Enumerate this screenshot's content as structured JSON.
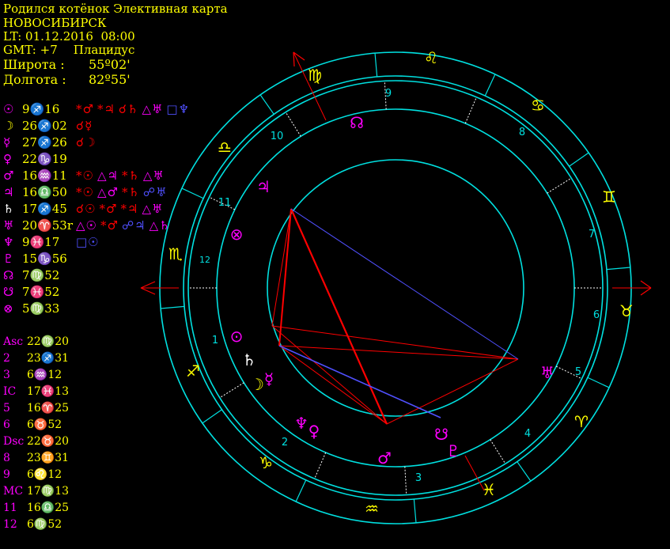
{
  "header": {
    "title": "Родился котёнок Элективная карта",
    "city": "НОВОСИБИРСК",
    "local_time": "LT: 01.12.2016  08:00",
    "gmt": "GMT: +7",
    "house_system": "Плацидус",
    "lat_label": "Широта :",
    "lat_value": "55º02'",
    "lon_label": "Долгота :",
    "lon_value": "82º55'"
  },
  "colors": {
    "ring": "#00e0e0",
    "text_yellow": "#ffff00",
    "magenta": "#ff00ff",
    "red": "#ff0000",
    "blue": "#5050ff",
    "white": "#ffffff"
  },
  "planets": [
    {
      "glyph": "☉",
      "color": "#ff00ff",
      "pos": "9♐16",
      "aspects": [
        {
          "t": "*♂",
          "c": "#ff0000"
        },
        {
          "t": "*♃",
          "c": "#ff0000"
        },
        {
          "t": "☌♄",
          "c": "#ff0000"
        },
        {
          "t": "△♅",
          "c": "#ff00ff"
        },
        {
          "t": "□♆",
          "c": "#5050ff"
        }
      ]
    },
    {
      "glyph": "☽",
      "color": "#ffff00",
      "pos": "26♐02",
      "aspects": [
        {
          "t": "☌☿",
          "c": "#ff0000"
        }
      ]
    },
    {
      "glyph": "☿",
      "color": "#ff00ff",
      "pos": "27♐26",
      "aspects": [
        {
          "t": "☌☽",
          "c": "#ff0000"
        }
      ]
    },
    {
      "glyph": "♀",
      "color": "#ff00ff",
      "pos": "22♑19",
      "aspects": []
    },
    {
      "glyph": "♂",
      "color": "#ff00ff",
      "pos": "16♒11",
      "aspects": [
        {
          "t": "*☉",
          "c": "#ff0000"
        },
        {
          "t": "△♃",
          "c": "#ff00ff"
        },
        {
          "t": "*♄",
          "c": "#ff0000"
        },
        {
          "t": "△♅",
          "c": "#ff00ff"
        }
      ]
    },
    {
      "glyph": "♃",
      "color": "#ff00ff",
      "pos": "16♎50",
      "aspects": [
        {
          "t": "*☉",
          "c": "#ff0000"
        },
        {
          "t": "△♂",
          "c": "#ff00ff"
        },
        {
          "t": "*♄",
          "c": "#ff0000"
        },
        {
          "t": "☍♅",
          "c": "#5050ff"
        }
      ]
    },
    {
      "glyph": "♄",
      "color": "#ffffff",
      "pos": "17♐45",
      "aspects": [
        {
          "t": "☌☉",
          "c": "#ff0000"
        },
        {
          "t": "*♂",
          "c": "#ff0000"
        },
        {
          "t": "*♃",
          "c": "#ff0000"
        },
        {
          "t": "△♅",
          "c": "#ff00ff"
        }
      ]
    },
    {
      "glyph": "♅",
      "color": "#ff00ff",
      "pos": "20♈53r",
      "aspects": [
        {
          "t": "△☉",
          "c": "#ff00ff"
        },
        {
          "t": "*♂",
          "c": "#ff0000"
        },
        {
          "t": "☍♃",
          "c": "#5050ff"
        },
        {
          "t": "△♄",
          "c": "#ff00ff"
        }
      ]
    },
    {
      "glyph": "♆",
      "color": "#ff00ff",
      "pos": "9♓17",
      "aspects": [
        {
          "t": "□☉",
          "c": "#5050ff"
        }
      ]
    },
    {
      "glyph": "♇",
      "color": "#ff00ff",
      "pos": "15♑56",
      "aspects": []
    },
    {
      "glyph": "☊",
      "color": "#ff00ff",
      "pos": "7♍52",
      "aspects": []
    },
    {
      "glyph": "☋",
      "color": "#ff00ff",
      "pos": "7♓52",
      "aspects": []
    },
    {
      "glyph": "⊗",
      "color": "#ff00ff",
      "pos": "5♍33",
      "aspects": []
    }
  ],
  "houses": [
    {
      "label": "Asc",
      "value": "22♍20"
    },
    {
      "label": "2",
      "value": "23♐31"
    },
    {
      "label": "3",
      "value": "6♒12"
    },
    {
      "label": "IC",
      "value": "17♓13"
    },
    {
      "label": "5",
      "value": "16♈25"
    },
    {
      "label": "6",
      "value": "6♉52"
    },
    {
      "label": "Dsc",
      "value": "22♉20"
    },
    {
      "label": "8",
      "value": "23♊31"
    },
    {
      "label": "9",
      "value": "6♌12"
    },
    {
      "label": "MC",
      "value": "17♍13"
    },
    {
      "label": "11",
      "value": "16♎25"
    },
    {
      "label": "12",
      "value": "6♍52"
    }
  ],
  "wheel": {
    "house_numbers": [
      "1",
      "2",
      "3",
      "4",
      "5",
      "6",
      "7",
      "8",
      "9",
      "10",
      "11",
      "12"
    ],
    "signs": [
      "♈",
      "♉",
      "♊",
      "♋",
      "♌",
      "♍",
      "♎",
      "♏",
      "♐",
      "♑",
      "♒",
      "♓"
    ]
  },
  "chart_planets": [
    {
      "glyph": "⊙",
      "color": "#ff00ff",
      "name": "sun"
    },
    {
      "glyph": "♄",
      "color": "#ffffff",
      "name": "saturn"
    },
    {
      "glyph": "☽",
      "color": "#ffff00",
      "name": "moon"
    },
    {
      "glyph": "☿",
      "color": "#ff00ff",
      "name": "mercury"
    },
    {
      "glyph": "♆",
      "color": "#ff00ff",
      "name": "neptune"
    },
    {
      "glyph": "♀",
      "color": "#ff00ff",
      "name": "venus"
    },
    {
      "glyph": "♂",
      "color": "#ff00ff",
      "name": "mars"
    },
    {
      "glyph": "☋",
      "color": "#ff00ff",
      "name": "south-node"
    },
    {
      "glyph": "♇",
      "color": "#ff00ff",
      "name": "pluto"
    },
    {
      "glyph": "♅",
      "color": "#ff00ff",
      "name": "uranus"
    },
    {
      "glyph": "☊",
      "color": "#ff00ff",
      "name": "north-node"
    },
    {
      "glyph": "♃",
      "color": "#ff00ff",
      "name": "jupiter"
    },
    {
      "glyph": "⊗",
      "color": "#ff00ff",
      "name": "fortune"
    }
  ]
}
